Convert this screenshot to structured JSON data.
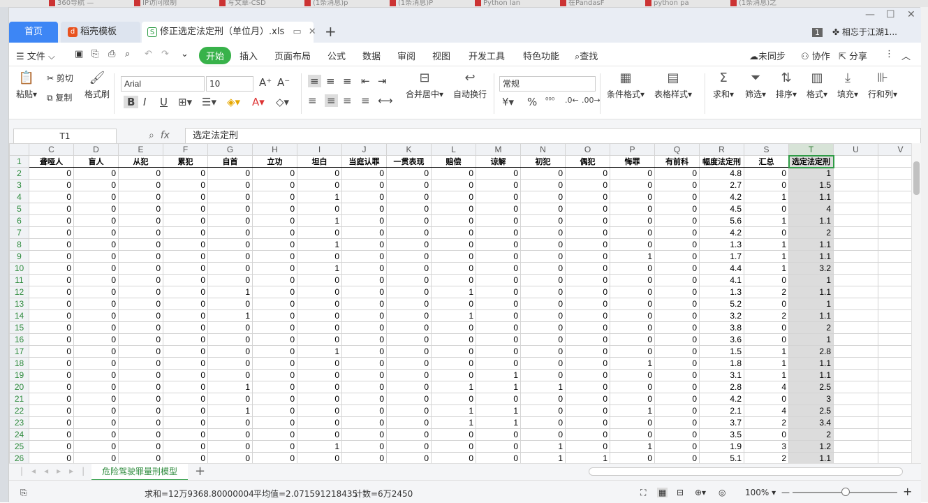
{
  "browser_tabs": [
    "360导航 —",
    "IP访问限制",
    "写文章-CSD",
    "(1条消息)p",
    "(1条消息)P",
    "Python lan",
    "在PandasF",
    "python pa",
    "(1条消息)之"
  ],
  "window": {
    "tabs": {
      "home": "首页",
      "template": "稻壳模板",
      "doc": "修正选定法定刑（单位月）.xls"
    },
    "account_badge": "1",
    "account_name": "相忘于江湖1..."
  },
  "menu": {
    "file": "文件",
    "items": [
      "开始",
      "插入",
      "页面布局",
      "公式",
      "数据",
      "审阅",
      "视图",
      "开发工具",
      "特色功能"
    ],
    "search": "查找",
    "sync": "未同步",
    "collab": "协作",
    "share": "分享"
  },
  "ribbon": {
    "paste": "粘贴",
    "cut": "剪切",
    "copy": "复制",
    "format_painter": "格式刷",
    "font_name": "Arial",
    "font_size": "10",
    "merge_center": "合并居中",
    "wrap": "自动换行",
    "number_format": "常规",
    "cond_format": "条件格式",
    "table_style": "表格样式",
    "sum": "求和",
    "filter": "筛选",
    "sort": "排序",
    "format": "格式",
    "fill": "填充",
    "row_col": "行和列"
  },
  "formula_bar": {
    "cell_ref": "T1",
    "fx": "fx",
    "content": "选定法定刑"
  },
  "sheet": {
    "columns": [
      "C",
      "D",
      "E",
      "F",
      "G",
      "H",
      "I",
      "J",
      "K",
      "L",
      "M",
      "N",
      "O",
      "P",
      "Q",
      "R",
      "S",
      "T",
      "U",
      "V"
    ],
    "headers": [
      "聋哑人",
      "盲人",
      "从犯",
      "累犯",
      "自首",
      "立功",
      "坦白",
      "当庭认罪",
      "一贯表现",
      "赔偿",
      "谅解",
      "初犯",
      "偶犯",
      "悔罪",
      "有前科",
      "幅度法定刑",
      "汇总",
      "选定法定刑"
    ],
    "rows": [
      {
        "n": "2",
        "v": [
          "0",
          "0",
          "0",
          "0",
          "0",
          "0",
          "0",
          "0",
          "0",
          "0",
          "0",
          "0",
          "0",
          "0",
          "0",
          "4.8",
          "0",
          "1"
        ]
      },
      {
        "n": "3",
        "v": [
          "0",
          "0",
          "0",
          "0",
          "0",
          "0",
          "0",
          "0",
          "0",
          "0",
          "0",
          "0",
          "0",
          "0",
          "0",
          "2.7",
          "0",
          "1.5"
        ]
      },
      {
        "n": "4",
        "v": [
          "0",
          "0",
          "0",
          "0",
          "0",
          "0",
          "1",
          "0",
          "0",
          "0",
          "0",
          "0",
          "0",
          "0",
          "0",
          "4.2",
          "1",
          "1.1"
        ]
      },
      {
        "n": "5",
        "v": [
          "0",
          "0",
          "0",
          "0",
          "0",
          "0",
          "0",
          "0",
          "0",
          "0",
          "0",
          "0",
          "0",
          "0",
          "0",
          "4.5",
          "0",
          "4"
        ]
      },
      {
        "n": "6",
        "v": [
          "0",
          "0",
          "0",
          "0",
          "0",
          "0",
          "1",
          "0",
          "0",
          "0",
          "0",
          "0",
          "0",
          "0",
          "0",
          "5.6",
          "1",
          "1.1"
        ]
      },
      {
        "n": "7",
        "v": [
          "0",
          "0",
          "0",
          "0",
          "0",
          "0",
          "0",
          "0",
          "0",
          "0",
          "0",
          "0",
          "0",
          "0",
          "0",
          "4.2",
          "0",
          "2"
        ]
      },
      {
        "n": "8",
        "v": [
          "0",
          "0",
          "0",
          "0",
          "0",
          "0",
          "1",
          "0",
          "0",
          "0",
          "0",
          "0",
          "0",
          "0",
          "0",
          "1.3",
          "1",
          "1.1"
        ]
      },
      {
        "n": "9",
        "v": [
          "0",
          "0",
          "0",
          "0",
          "0",
          "0",
          "0",
          "0",
          "0",
          "0",
          "0",
          "0",
          "0",
          "1",
          "0",
          "1.7",
          "1",
          "1.1"
        ]
      },
      {
        "n": "10",
        "v": [
          "0",
          "0",
          "0",
          "0",
          "0",
          "0",
          "1",
          "0",
          "0",
          "0",
          "0",
          "0",
          "0",
          "0",
          "0",
          "4.4",
          "1",
          "3.2"
        ]
      },
      {
        "n": "11",
        "v": [
          "0",
          "0",
          "0",
          "0",
          "0",
          "0",
          "0",
          "0",
          "0",
          "0",
          "0",
          "0",
          "0",
          "0",
          "0",
          "4.1",
          "0",
          "1"
        ]
      },
      {
        "n": "12",
        "v": [
          "0",
          "0",
          "0",
          "0",
          "1",
          "0",
          "0",
          "0",
          "0",
          "1",
          "0",
          "0",
          "0",
          "0",
          "0",
          "1.3",
          "2",
          "1.1"
        ]
      },
      {
        "n": "13",
        "v": [
          "0",
          "0",
          "0",
          "0",
          "0",
          "0",
          "0",
          "0",
          "0",
          "0",
          "0",
          "0",
          "0",
          "0",
          "0",
          "5.2",
          "0",
          "1"
        ]
      },
      {
        "n": "14",
        "v": [
          "0",
          "0",
          "0",
          "0",
          "1",
          "0",
          "0",
          "0",
          "0",
          "1",
          "0",
          "0",
          "0",
          "0",
          "0",
          "3.2",
          "2",
          "1.1"
        ]
      },
      {
        "n": "15",
        "v": [
          "0",
          "0",
          "0",
          "0",
          "0",
          "0",
          "0",
          "0",
          "0",
          "0",
          "0",
          "0",
          "0",
          "0",
          "0",
          "3.8",
          "0",
          "2"
        ]
      },
      {
        "n": "16",
        "v": [
          "0",
          "0",
          "0",
          "0",
          "0",
          "0",
          "0",
          "0",
          "0",
          "0",
          "0",
          "0",
          "0",
          "0",
          "0",
          "3.6",
          "0",
          "1"
        ]
      },
      {
        "n": "17",
        "v": [
          "0",
          "0",
          "0",
          "0",
          "0",
          "0",
          "1",
          "0",
          "0",
          "0",
          "0",
          "0",
          "0",
          "0",
          "0",
          "1.5",
          "1",
          "2.8"
        ]
      },
      {
        "n": "18",
        "v": [
          "0",
          "0",
          "0",
          "0",
          "0",
          "0",
          "0",
          "0",
          "0",
          "0",
          "0",
          "0",
          "0",
          "1",
          "0",
          "1.8",
          "1",
          "1.1"
        ]
      },
      {
        "n": "19",
        "v": [
          "0",
          "0",
          "0",
          "0",
          "0",
          "0",
          "0",
          "0",
          "0",
          "0",
          "1",
          "0",
          "0",
          "0",
          "0",
          "3.1",
          "1",
          "1.1"
        ]
      },
      {
        "n": "20",
        "v": [
          "0",
          "0",
          "0",
          "0",
          "1",
          "0",
          "0",
          "0",
          "0",
          "1",
          "1",
          "1",
          "0",
          "0",
          "0",
          "2.8",
          "4",
          "2.5"
        ]
      },
      {
        "n": "21",
        "v": [
          "0",
          "0",
          "0",
          "0",
          "0",
          "0",
          "0",
          "0",
          "0",
          "0",
          "0",
          "0",
          "0",
          "0",
          "0",
          "4.2",
          "0",
          "3"
        ]
      },
      {
        "n": "22",
        "v": [
          "0",
          "0",
          "0",
          "0",
          "1",
          "0",
          "0",
          "0",
          "0",
          "1",
          "1",
          "0",
          "0",
          "1",
          "0",
          "2.1",
          "4",
          "2.5"
        ]
      },
      {
        "n": "23",
        "v": [
          "0",
          "0",
          "0",
          "0",
          "0",
          "0",
          "0",
          "0",
          "0",
          "1",
          "1",
          "0",
          "0",
          "0",
          "0",
          "3.7",
          "2",
          "3.4"
        ]
      },
      {
        "n": "24",
        "v": [
          "0",
          "0",
          "0",
          "0",
          "0",
          "0",
          "0",
          "0",
          "0",
          "0",
          "0",
          "0",
          "0",
          "0",
          "0",
          "3.5",
          "0",
          "2"
        ]
      },
      {
        "n": "25",
        "v": [
          "0",
          "0",
          "0",
          "0",
          "0",
          "0",
          "1",
          "0",
          "0",
          "0",
          "0",
          "1",
          "0",
          "1",
          "0",
          "1.9",
          "3",
          "1.2"
        ]
      },
      {
        "n": "26",
        "v": [
          "0",
          "0",
          "0",
          "0",
          "0",
          "0",
          "0",
          "0",
          "0",
          "0",
          "0",
          "1",
          "1",
          "0",
          "0",
          "5.1",
          "2",
          "1.1"
        ]
      }
    ],
    "tab_name": "危险驾驶罪量刑模型"
  },
  "status": {
    "sum": "求和=12万9368.80000004",
    "avg": "平均值=2.071591218435",
    "count": "计数=6万2450",
    "zoom": "100%"
  },
  "colors": {
    "accent_green": "#38b24a",
    "home_tab_blue": "#3d86f5",
    "selection_border": "#2e9c45"
  }
}
